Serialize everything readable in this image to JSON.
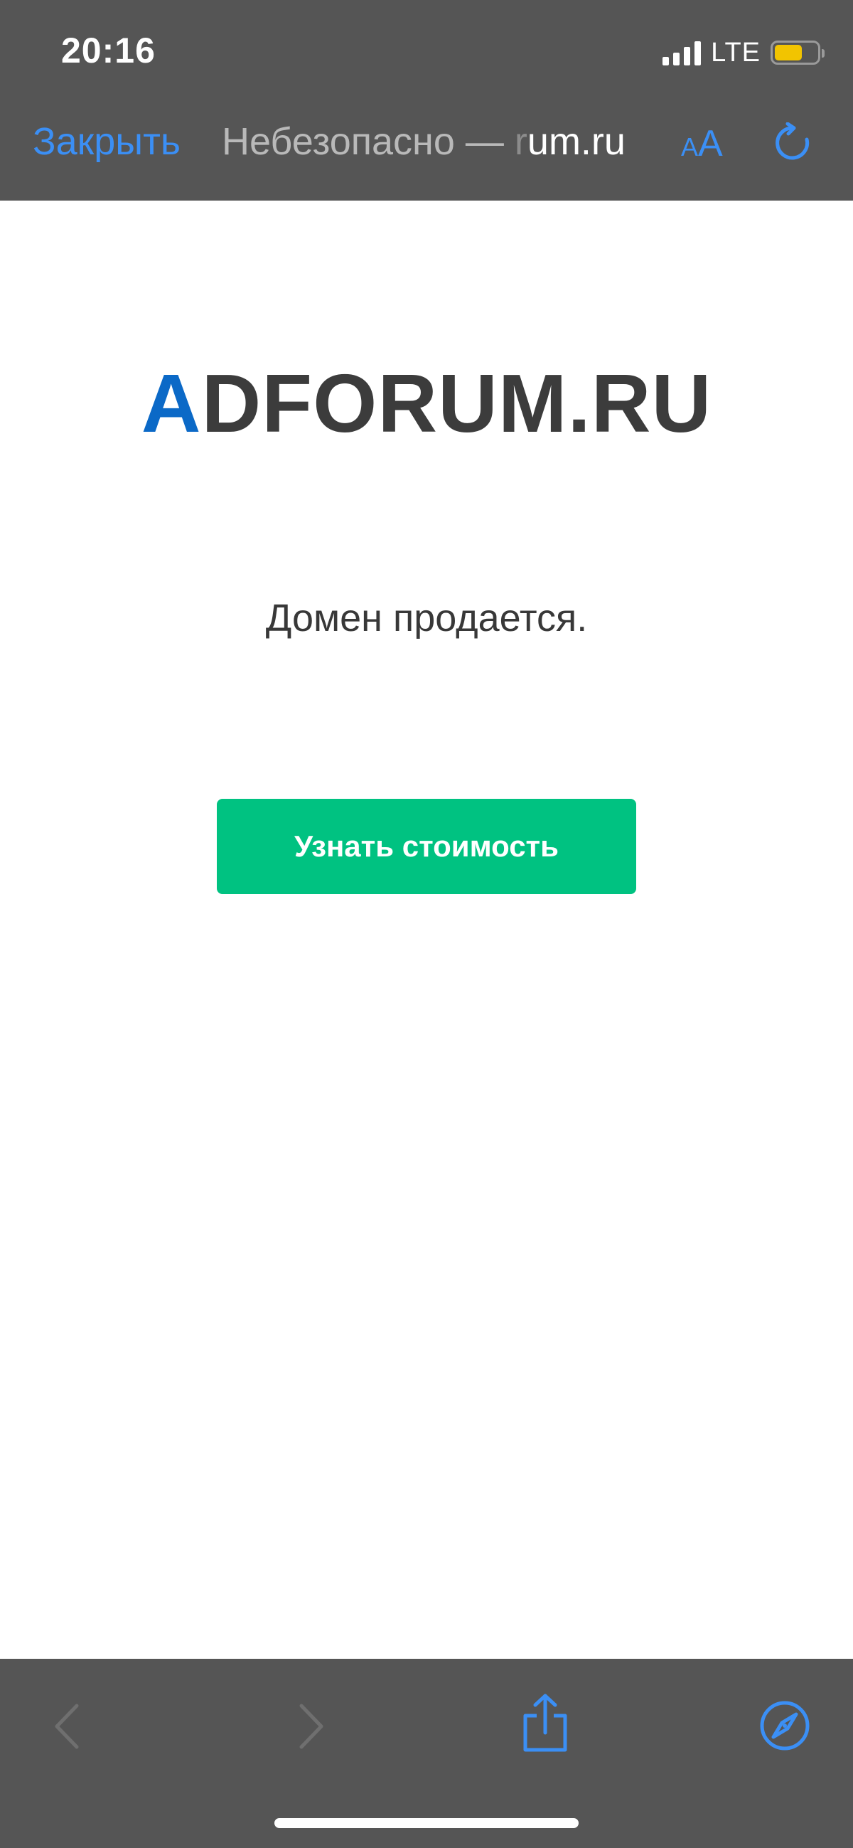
{
  "status_bar": {
    "time": "20:16",
    "network": "LTE",
    "battery_color": "#f2c400"
  },
  "browser": {
    "close_label": "Закрыть",
    "address_prefix": "Небезопасно — ",
    "address_faded": "r",
    "address_domain": "um.ru",
    "text_size_small": "A",
    "text_size_large": "A",
    "accent_color": "#3b8ff5",
    "reload_icon": "reload-icon"
  },
  "page": {
    "logo_accent": "A",
    "logo_rest": "DFORUM.RU",
    "logo_accent_color": "#0b69c7",
    "sale_text": "Домен продается.",
    "price_button_label": "Узнать стоимость",
    "price_button_color": "#00c281"
  },
  "toolbar": {
    "icons": [
      "back-icon",
      "forward-icon",
      "share-icon",
      "compass-icon"
    ]
  }
}
